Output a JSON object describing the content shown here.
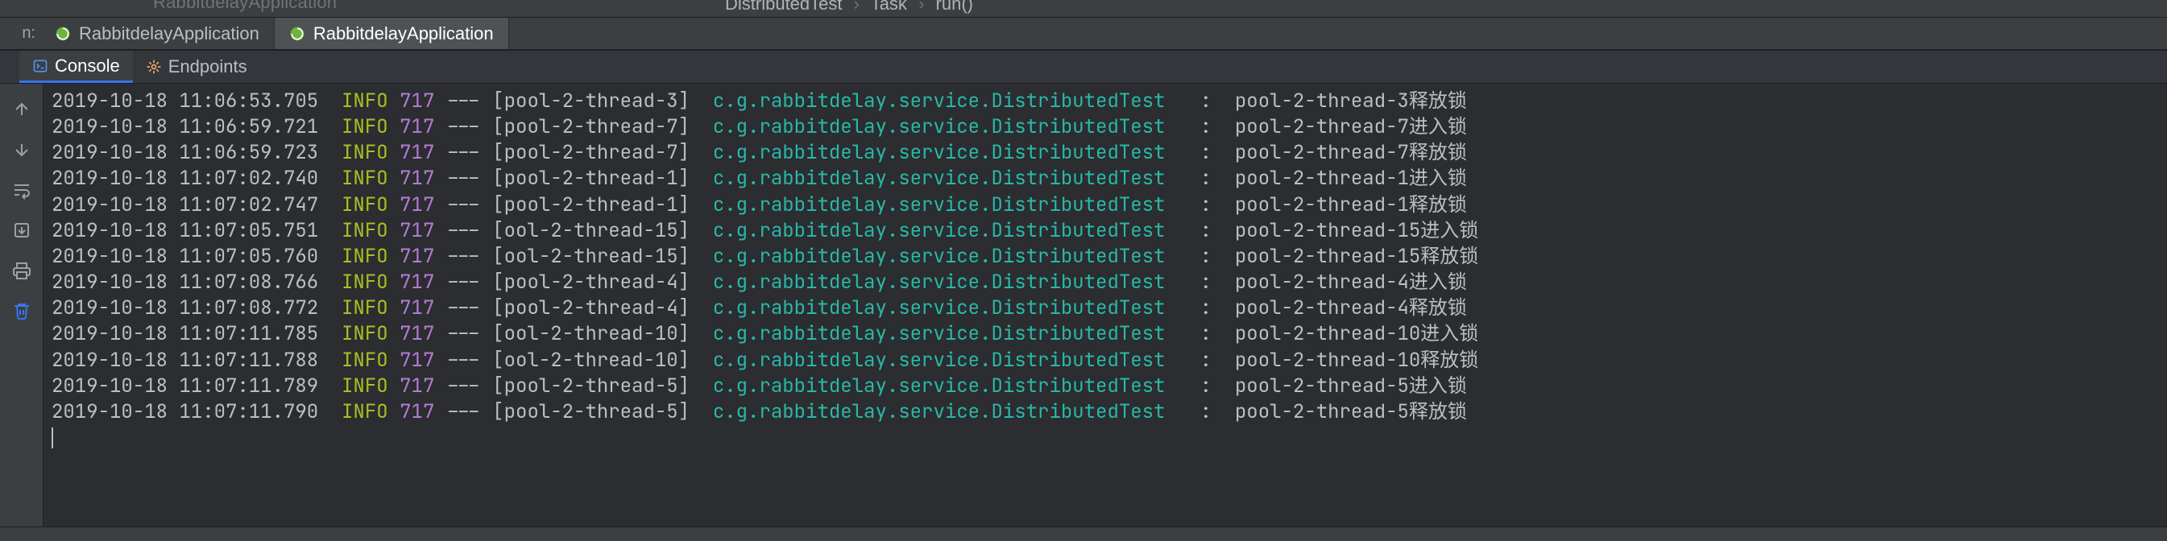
{
  "breadcrumb": {
    "faded_app": "RabbitdelayApplication",
    "parts": [
      "DistributedTest",
      "Task",
      "run()"
    ]
  },
  "run_label_suffix": "n:",
  "run_tabs": [
    {
      "label": "RabbitdelayApplication",
      "active": false
    },
    {
      "label": "RabbitdelayApplication",
      "active": true
    }
  ],
  "tool_tabs": [
    {
      "label": "Console",
      "icon": "console-icon",
      "active": true
    },
    {
      "label": "Endpoints",
      "icon": "endpoints-icon",
      "active": false
    }
  ],
  "gutter_icons": [
    "arrow-up-icon",
    "arrow-down-icon",
    "soft-wrap-icon",
    "scroll-to-end-icon",
    "print-icon",
    "trash-icon"
  ],
  "log_columns": {
    "level": "INFO",
    "pid": "717",
    "dashes": "---",
    "logger": "c.g.rabbitdelay.service.DistributedTest",
    "sep": ":"
  },
  "log_rows": [
    {
      "ts": "2019-10-18 11:06:53.705",
      "thread": "[pool-2-thread-3]",
      "msg": "pool-2-thread-3释放锁"
    },
    {
      "ts": "2019-10-18 11:06:59.721",
      "thread": "[pool-2-thread-7]",
      "msg": "pool-2-thread-7进入锁"
    },
    {
      "ts": "2019-10-18 11:06:59.723",
      "thread": "[pool-2-thread-7]",
      "msg": "pool-2-thread-7释放锁"
    },
    {
      "ts": "2019-10-18 11:07:02.740",
      "thread": "[pool-2-thread-1]",
      "msg": "pool-2-thread-1进入锁"
    },
    {
      "ts": "2019-10-18 11:07:02.747",
      "thread": "[pool-2-thread-1]",
      "msg": "pool-2-thread-1释放锁"
    },
    {
      "ts": "2019-10-18 11:07:05.751",
      "thread": "[ool-2-thread-15]",
      "msg": "pool-2-thread-15进入锁"
    },
    {
      "ts": "2019-10-18 11:07:05.760",
      "thread": "[ool-2-thread-15]",
      "msg": "pool-2-thread-15释放锁"
    },
    {
      "ts": "2019-10-18 11:07:08.766",
      "thread": "[pool-2-thread-4]",
      "msg": "pool-2-thread-4进入锁"
    },
    {
      "ts": "2019-10-18 11:07:08.772",
      "thread": "[pool-2-thread-4]",
      "msg": "pool-2-thread-4释放锁"
    },
    {
      "ts": "2019-10-18 11:07:11.785",
      "thread": "[ool-2-thread-10]",
      "msg": "pool-2-thread-10进入锁"
    },
    {
      "ts": "2019-10-18 11:07:11.788",
      "thread": "[ool-2-thread-10]",
      "msg": "pool-2-thread-10释放锁"
    },
    {
      "ts": "2019-10-18 11:07:11.789",
      "thread": "[pool-2-thread-5]",
      "msg": "pool-2-thread-5进入锁"
    },
    {
      "ts": "2019-10-18 11:07:11.790",
      "thread": "[pool-2-thread-5]",
      "msg": "pool-2-thread-5释放锁"
    }
  ]
}
